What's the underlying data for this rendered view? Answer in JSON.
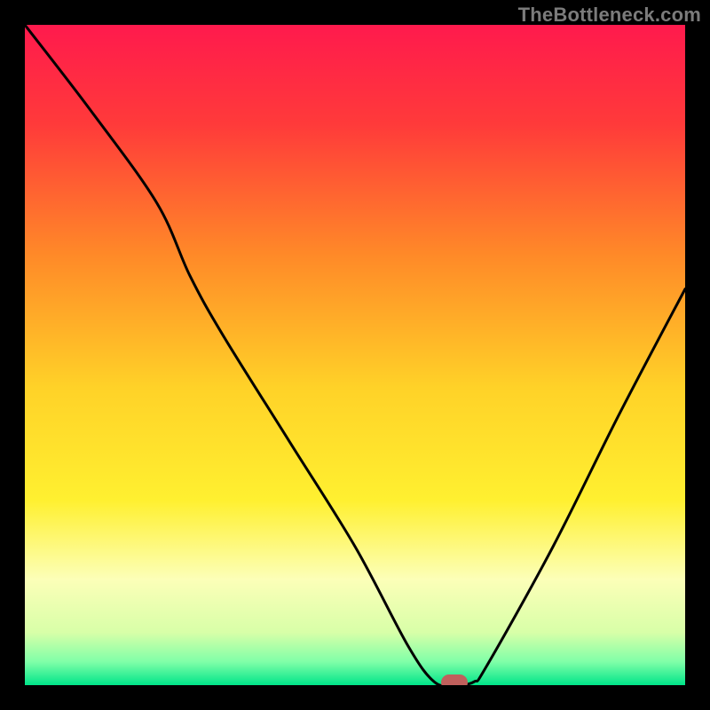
{
  "attribution": "TheBottleneck.com",
  "colors": {
    "frame": "#000000",
    "curve": "#000000",
    "marker": "#c0605c",
    "gradient_stops": [
      {
        "offset": 0.0,
        "color": "#ff1a4d"
      },
      {
        "offset": 0.15,
        "color": "#ff3a3a"
      },
      {
        "offset": 0.35,
        "color": "#ff8a28"
      },
      {
        "offset": 0.55,
        "color": "#ffd228"
      },
      {
        "offset": 0.72,
        "color": "#fff030"
      },
      {
        "offset": 0.84,
        "color": "#fcffb8"
      },
      {
        "offset": 0.92,
        "color": "#d8ffa8"
      },
      {
        "offset": 0.965,
        "color": "#7fffa8"
      },
      {
        "offset": 1.0,
        "color": "#00e589"
      }
    ]
  },
  "chart_data": {
    "type": "line",
    "title": "",
    "xlabel": "",
    "ylabel": "",
    "xlim": [
      0,
      100
    ],
    "ylim": [
      0,
      100
    ],
    "grid": false,
    "legend": false,
    "x": [
      0,
      10,
      20,
      25,
      30,
      40,
      50,
      58,
      62,
      65,
      68,
      70,
      80,
      90,
      100
    ],
    "values": [
      100,
      87,
      73,
      62,
      53,
      37,
      21,
      6,
      0.5,
      0,
      0.5,
      3,
      21,
      41,
      60
    ],
    "marker": {
      "x": 65,
      "y": 0
    }
  }
}
